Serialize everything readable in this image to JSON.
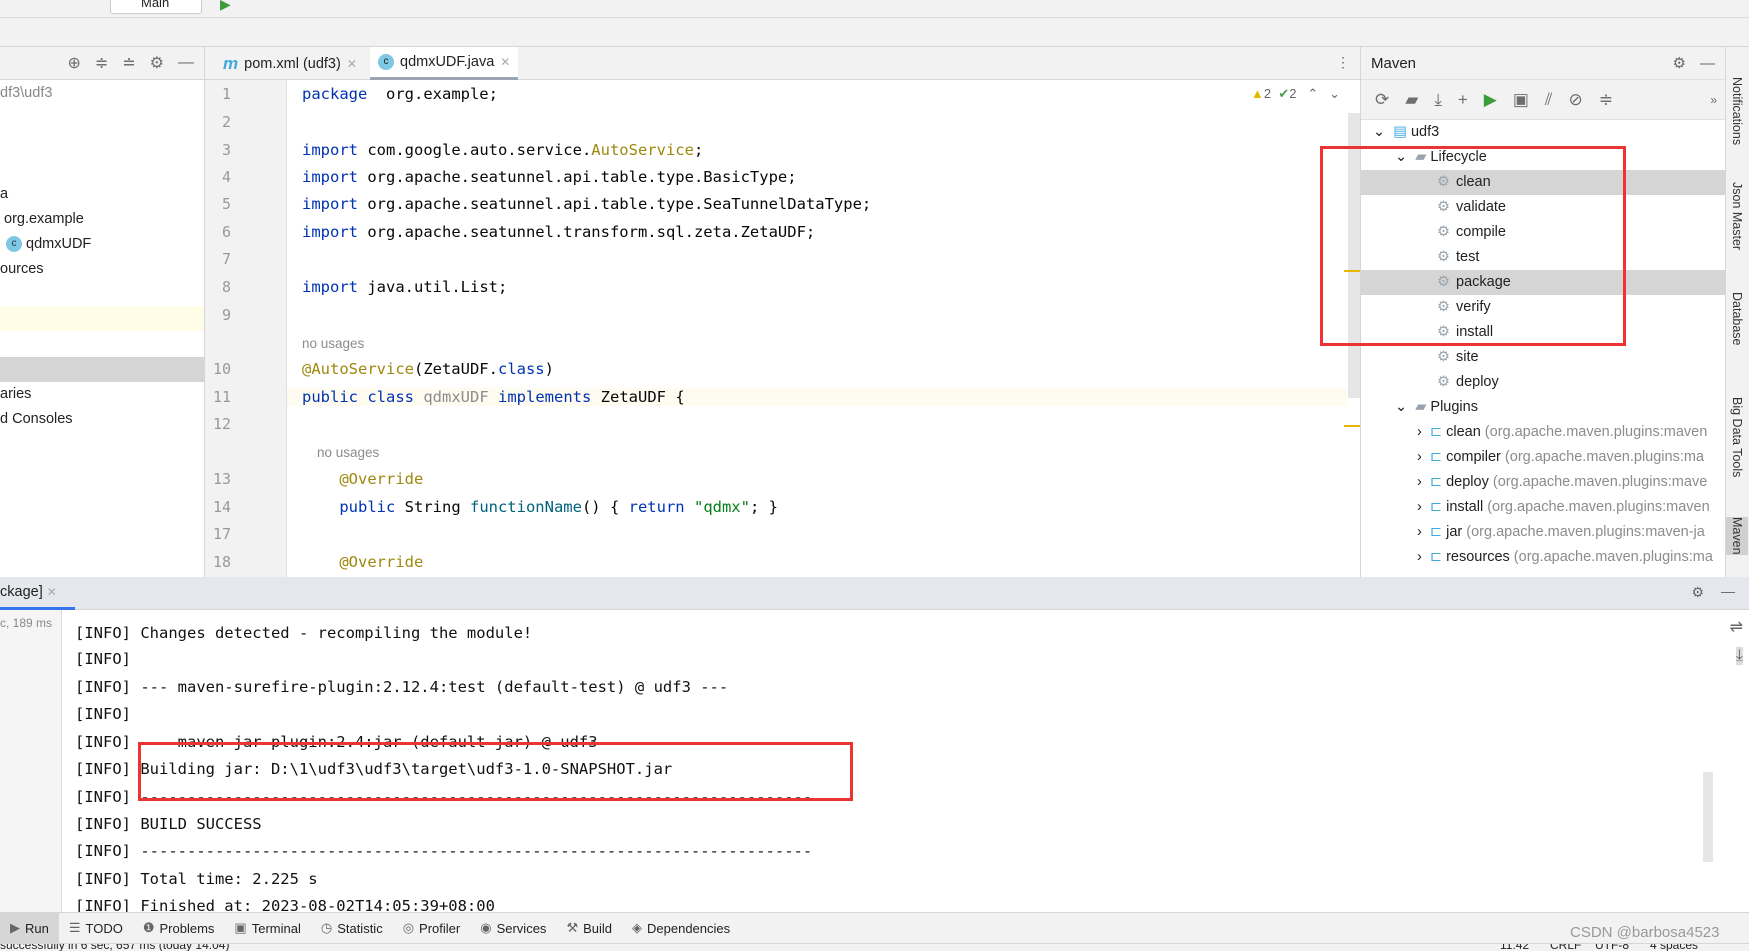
{
  "toolbar": {
    "run_config": "Main"
  },
  "project": {
    "path": "df3\\udf3",
    "items": [
      "a",
      "org.example",
      "qdmxUDF",
      "ources",
      "aries",
      "d Consoles"
    ]
  },
  "tabs": [
    {
      "label": "pom.xml (udf3)",
      "icon": "m"
    },
    {
      "label": "qdmxUDF.java",
      "icon": "c",
      "active": true
    }
  ],
  "inspections": {
    "warnings": "2",
    "ok": "2"
  },
  "editor": {
    "lines": [
      {
        "n": "1",
        "parts": [
          [
            "kw",
            "package"
          ],
          [
            "",
            "  org.example;"
          ]
        ]
      },
      {
        "n": "2",
        "parts": []
      },
      {
        "n": "3",
        "parts": [
          [
            "kw",
            "import"
          ],
          [
            "",
            " com.google.auto.service."
          ],
          [
            "an",
            "AutoService"
          ],
          [
            "",
            ";"
          ]
        ]
      },
      {
        "n": "4",
        "parts": [
          [
            "kw",
            "import"
          ],
          [
            "",
            " org.apache.seatunnel.api.table.type.BasicType;"
          ]
        ]
      },
      {
        "n": "5",
        "parts": [
          [
            "kw",
            "import"
          ],
          [
            "",
            " org.apache.seatunnel.api.table.type.SeaTunnelDataType;"
          ]
        ]
      },
      {
        "n": "6",
        "parts": [
          [
            "kw",
            "import"
          ],
          [
            "",
            " org.apache.seatunnel.transform.sql.zeta.ZetaUDF;"
          ]
        ]
      },
      {
        "n": "7",
        "parts": []
      },
      {
        "n": "8",
        "parts": [
          [
            "kw",
            "import"
          ],
          [
            "",
            " java.util.List;"
          ]
        ]
      },
      {
        "n": "9",
        "parts": []
      },
      {
        "n": "",
        "parts": [
          [
            "gr",
            "no usages"
          ]
        ]
      },
      {
        "n": "10",
        "parts": [
          [
            "an",
            "@AutoService"
          ],
          [
            "",
            "(ZetaUDF."
          ],
          [
            "kw",
            "class"
          ],
          [
            "",
            ")"
          ]
        ]
      },
      {
        "n": "11",
        "parts": [
          [
            "kw",
            "public class"
          ],
          [
            "",
            " "
          ],
          [
            "gr2",
            "qdmxUDF"
          ],
          [
            "",
            " "
          ],
          [
            "kw",
            "implements"
          ],
          [
            "",
            " ZetaUDF {"
          ]
        ]
      },
      {
        "n": "12",
        "parts": []
      },
      {
        "n": "",
        "parts": [
          [
            "gr",
            "    no usages"
          ]
        ]
      },
      {
        "n": "13",
        "parts": [
          [
            "an",
            "    @Override"
          ]
        ]
      },
      {
        "n": "14",
        "parts": [
          [
            "kw",
            "    public"
          ],
          [
            "",
            " String "
          ],
          [
            "fn",
            "functionName"
          ],
          [
            "",
            "() { "
          ],
          [
            "kw",
            "return"
          ],
          [
            "",
            " "
          ],
          [
            "st",
            "\"qdmx\""
          ],
          [
            "",
            "; }"
          ]
        ]
      },
      {
        "n": "17",
        "parts": []
      },
      {
        "n": "18",
        "parts": [
          [
            "an",
            "    @Override"
          ]
        ]
      }
    ]
  },
  "maven": {
    "title": "Maven",
    "project": "udf3",
    "lifecycle_label": "Lifecycle",
    "lifecycle": [
      "clean",
      "validate",
      "compile",
      "test",
      "package",
      "verify",
      "install",
      "site",
      "deploy"
    ],
    "selected": [
      "clean",
      "package"
    ],
    "plugins_label": "Plugins",
    "plugins": [
      {
        "name": "clean",
        "coord": "(org.apache.maven.plugins:maven"
      },
      {
        "name": "compiler",
        "coord": "(org.apache.maven.plugins:ma"
      },
      {
        "name": "deploy",
        "coord": "(org.apache.maven.plugins:mave"
      },
      {
        "name": "install",
        "coord": "(org.apache.maven.plugins:maven"
      },
      {
        "name": "jar",
        "coord": "(org.apache.maven.plugins:maven-ja"
      },
      {
        "name": "resources",
        "coord": "(org.apache.maven.plugins:ma"
      }
    ]
  },
  "side_tools": [
    "Notifications",
    "Json Master",
    "Database",
    "Big Data Tools",
    "Maven"
  ],
  "run": {
    "tab": "ckage]",
    "elapsed": "c, 189 ms",
    "lines": [
      "[INFO] Changes detected - recompiling the module!",
      "[INFO]",
      "[INFO] --- maven-surefire-plugin:2.12.4:test (default-test) @ udf3 ---",
      "[INFO]",
      "[INFO] --- maven-jar-plugin:2.4:jar (default-jar) @ udf3 ---",
      "[INFO] Building jar: D:\\1\\udf3\\udf3\\target\\udf3-1.0-SNAPSHOT.jar",
      "[INFO] ------------------------------------------------------------------------",
      "[INFO] BUILD SUCCESS",
      "[INFO] ------------------------------------------------------------------------",
      "[INFO] Total time: 2.225 s",
      "[INFO] Finished at: 2023-08-02T14:05:39+08:00"
    ]
  },
  "tool_windows": [
    "Run",
    "TODO",
    "Problems",
    "Terminal",
    "Statistic",
    "Profiler",
    "Services",
    "Build",
    "Dependencies"
  ],
  "status": {
    "message": "successfully in 6 sec, 657 ms (today 14:04)",
    "position": "11:42",
    "line_sep": "CRLF",
    "encoding": "UTF-8",
    "indent": "4 spaces"
  },
  "watermark": "CSDN @barbosa4523",
  "colors": {
    "highlight_box": "#ee3333",
    "keyword": "#0033b3",
    "annotation": "#9e880d",
    "string": "#067d17"
  }
}
